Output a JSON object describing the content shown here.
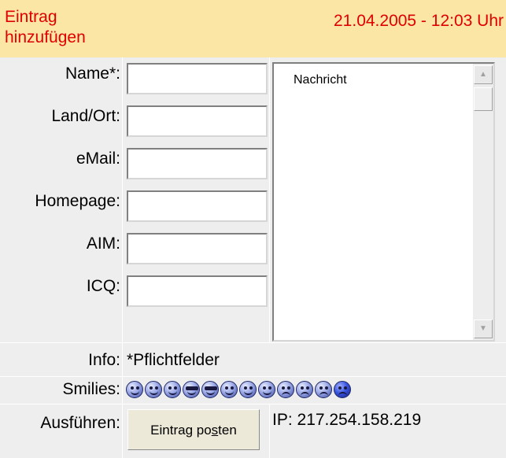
{
  "header": {
    "title_line1": "Eintrag",
    "title_line2": "hinzufügen",
    "datetime": "21.04.2005 - 12:03 Uhr"
  },
  "form": {
    "fields": [
      {
        "label": "Name*:",
        "value": ""
      },
      {
        "label": "Land/Ort:",
        "value": ""
      },
      {
        "label": "eMail:",
        "value": ""
      },
      {
        "label": "Homepage:",
        "value": ""
      },
      {
        "label": "AIM:",
        "value": ""
      },
      {
        "label": "ICQ:",
        "value": ""
      }
    ],
    "message": {
      "value": "Nachricht"
    }
  },
  "info": {
    "label": "Info:",
    "text": "*Pflichtfelder"
  },
  "smilies": {
    "label": "Smilies:",
    "icons": [
      "grin-icon",
      "smile-icon",
      "smile-icon",
      "cool-icon",
      "cool-icon",
      "smile-icon",
      "happy-icon",
      "nerd-icon",
      "sad-icon",
      "sad-icon",
      "sad-icon",
      "angry-icon"
    ]
  },
  "actions": {
    "label": "Ausführen:",
    "submit_pre": "Eintrag po",
    "submit_accel": "s",
    "submit_post": "ten",
    "ip": "IP: 217.254.158.219"
  },
  "colors": {
    "header_bg": "#fce6a6",
    "header_text": "#e00000",
    "row_bg": "#eeeeee"
  }
}
